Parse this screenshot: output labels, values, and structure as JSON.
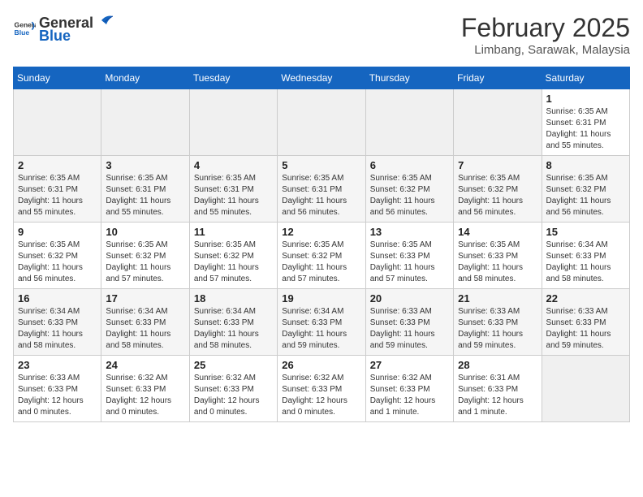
{
  "header": {
    "logo_general": "General",
    "logo_blue": "Blue",
    "title": "February 2025",
    "subtitle": "Limbang, Sarawak, Malaysia"
  },
  "days_of_week": [
    "Sunday",
    "Monday",
    "Tuesday",
    "Wednesday",
    "Thursday",
    "Friday",
    "Saturday"
  ],
  "weeks": [
    [
      {
        "day": "",
        "empty": true
      },
      {
        "day": "",
        "empty": true
      },
      {
        "day": "",
        "empty": true
      },
      {
        "day": "",
        "empty": true
      },
      {
        "day": "",
        "empty": true
      },
      {
        "day": "",
        "empty": true
      },
      {
        "day": "1",
        "sunrise": "6:35 AM",
        "sunset": "6:31 PM",
        "daylight": "11 hours and 55 minutes."
      }
    ],
    [
      {
        "day": "2",
        "sunrise": "6:35 AM",
        "sunset": "6:31 PM",
        "daylight": "11 hours and 55 minutes."
      },
      {
        "day": "3",
        "sunrise": "6:35 AM",
        "sunset": "6:31 PM",
        "daylight": "11 hours and 55 minutes."
      },
      {
        "day": "4",
        "sunrise": "6:35 AM",
        "sunset": "6:31 PM",
        "daylight": "11 hours and 55 minutes."
      },
      {
        "day": "5",
        "sunrise": "6:35 AM",
        "sunset": "6:31 PM",
        "daylight": "11 hours and 56 minutes."
      },
      {
        "day": "6",
        "sunrise": "6:35 AM",
        "sunset": "6:32 PM",
        "daylight": "11 hours and 56 minutes."
      },
      {
        "day": "7",
        "sunrise": "6:35 AM",
        "sunset": "6:32 PM",
        "daylight": "11 hours and 56 minutes."
      },
      {
        "day": "8",
        "sunrise": "6:35 AM",
        "sunset": "6:32 PM",
        "daylight": "11 hours and 56 minutes."
      }
    ],
    [
      {
        "day": "9",
        "sunrise": "6:35 AM",
        "sunset": "6:32 PM",
        "daylight": "11 hours and 56 minutes."
      },
      {
        "day": "10",
        "sunrise": "6:35 AM",
        "sunset": "6:32 PM",
        "daylight": "11 hours and 57 minutes."
      },
      {
        "day": "11",
        "sunrise": "6:35 AM",
        "sunset": "6:32 PM",
        "daylight": "11 hours and 57 minutes."
      },
      {
        "day": "12",
        "sunrise": "6:35 AM",
        "sunset": "6:32 PM",
        "daylight": "11 hours and 57 minutes."
      },
      {
        "day": "13",
        "sunrise": "6:35 AM",
        "sunset": "6:33 PM",
        "daylight": "11 hours and 57 minutes."
      },
      {
        "day": "14",
        "sunrise": "6:35 AM",
        "sunset": "6:33 PM",
        "daylight": "11 hours and 58 minutes."
      },
      {
        "day": "15",
        "sunrise": "6:34 AM",
        "sunset": "6:33 PM",
        "daylight": "11 hours and 58 minutes."
      }
    ],
    [
      {
        "day": "16",
        "sunrise": "6:34 AM",
        "sunset": "6:33 PM",
        "daylight": "11 hours and 58 minutes."
      },
      {
        "day": "17",
        "sunrise": "6:34 AM",
        "sunset": "6:33 PM",
        "daylight": "11 hours and 58 minutes."
      },
      {
        "day": "18",
        "sunrise": "6:34 AM",
        "sunset": "6:33 PM",
        "daylight": "11 hours and 58 minutes."
      },
      {
        "day": "19",
        "sunrise": "6:34 AM",
        "sunset": "6:33 PM",
        "daylight": "11 hours and 59 minutes."
      },
      {
        "day": "20",
        "sunrise": "6:33 AM",
        "sunset": "6:33 PM",
        "daylight": "11 hours and 59 minutes."
      },
      {
        "day": "21",
        "sunrise": "6:33 AM",
        "sunset": "6:33 PM",
        "daylight": "11 hours and 59 minutes."
      },
      {
        "day": "22",
        "sunrise": "6:33 AM",
        "sunset": "6:33 PM",
        "daylight": "11 hours and 59 minutes."
      }
    ],
    [
      {
        "day": "23",
        "sunrise": "6:33 AM",
        "sunset": "6:33 PM",
        "daylight": "12 hours and 0 minutes."
      },
      {
        "day": "24",
        "sunrise": "6:32 AM",
        "sunset": "6:33 PM",
        "daylight": "12 hours and 0 minutes."
      },
      {
        "day": "25",
        "sunrise": "6:32 AM",
        "sunset": "6:33 PM",
        "daylight": "12 hours and 0 minutes."
      },
      {
        "day": "26",
        "sunrise": "6:32 AM",
        "sunset": "6:33 PM",
        "daylight": "12 hours and 0 minutes."
      },
      {
        "day": "27",
        "sunrise": "6:32 AM",
        "sunset": "6:33 PM",
        "daylight": "12 hours and 1 minute."
      },
      {
        "day": "28",
        "sunrise": "6:31 AM",
        "sunset": "6:33 PM",
        "daylight": "12 hours and 1 minute."
      },
      {
        "day": "",
        "empty": true
      }
    ]
  ],
  "labels": {
    "sunrise": "Sunrise:",
    "sunset": "Sunset:",
    "daylight": "Daylight:"
  }
}
